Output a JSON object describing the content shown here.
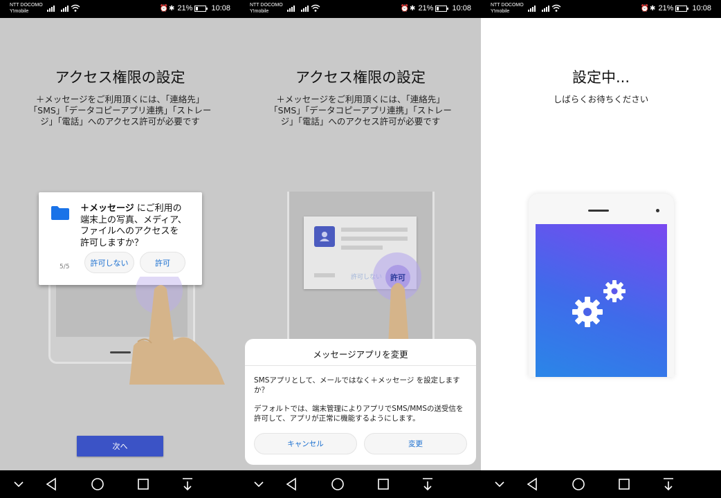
{
  "status": {
    "carrier_line1": "NTT DOCOMO",
    "carrier_line2": "Y!mobile",
    "icons": "⏰✱",
    "battery": "21%",
    "time": "10:08"
  },
  "panel1": {
    "title": "アクセス権限の設定",
    "subtitle": "＋メッセージをご利用頂くには、「連絡先」\n「SMS」「データコピーアプリ連携」「ストレー\nジ」「電話」へのアクセス許可が必要です",
    "dialog": {
      "app_name": "＋メッセージ",
      "message": " にご利用の\n端末上の写真、メディア、\nファイルへのアクセスを\n許可しますか？",
      "counter": "5/5",
      "deny_label": "許可しない",
      "allow_label": "許可"
    },
    "next_label": "次へ"
  },
  "panel2": {
    "title": "アクセス権限の設定",
    "subtitle": "＋メッセージをご利用頂くには、「連絡先」\n「SMS」「データコピーアプリ連携」「ストレー\nジ」「電話」へのアクセス許可が必要です",
    "illustration": {
      "deny_label": "許可しない",
      "allow_label": "許可"
    },
    "sheet": {
      "title": "メッセージアプリを変更",
      "body1": "SMSアプリとして、メールではなく＋メッセージ を設定しますか？",
      "body2": "デフォルトでは、端末管理によりアプリでSMS/MMSの送受信を許可して、アプリが正常に機能するようにします。",
      "cancel_label": "キャンセル",
      "change_label": "変更"
    }
  },
  "panel3": {
    "title": "設定中...",
    "subtitle": "しばらくお待ちください"
  },
  "colors": {
    "primary_button": "#3b53c6",
    "link_blue": "#1a6fd0",
    "gradient_top": "#7a48f0",
    "gradient_bottom": "#2a86e8"
  }
}
